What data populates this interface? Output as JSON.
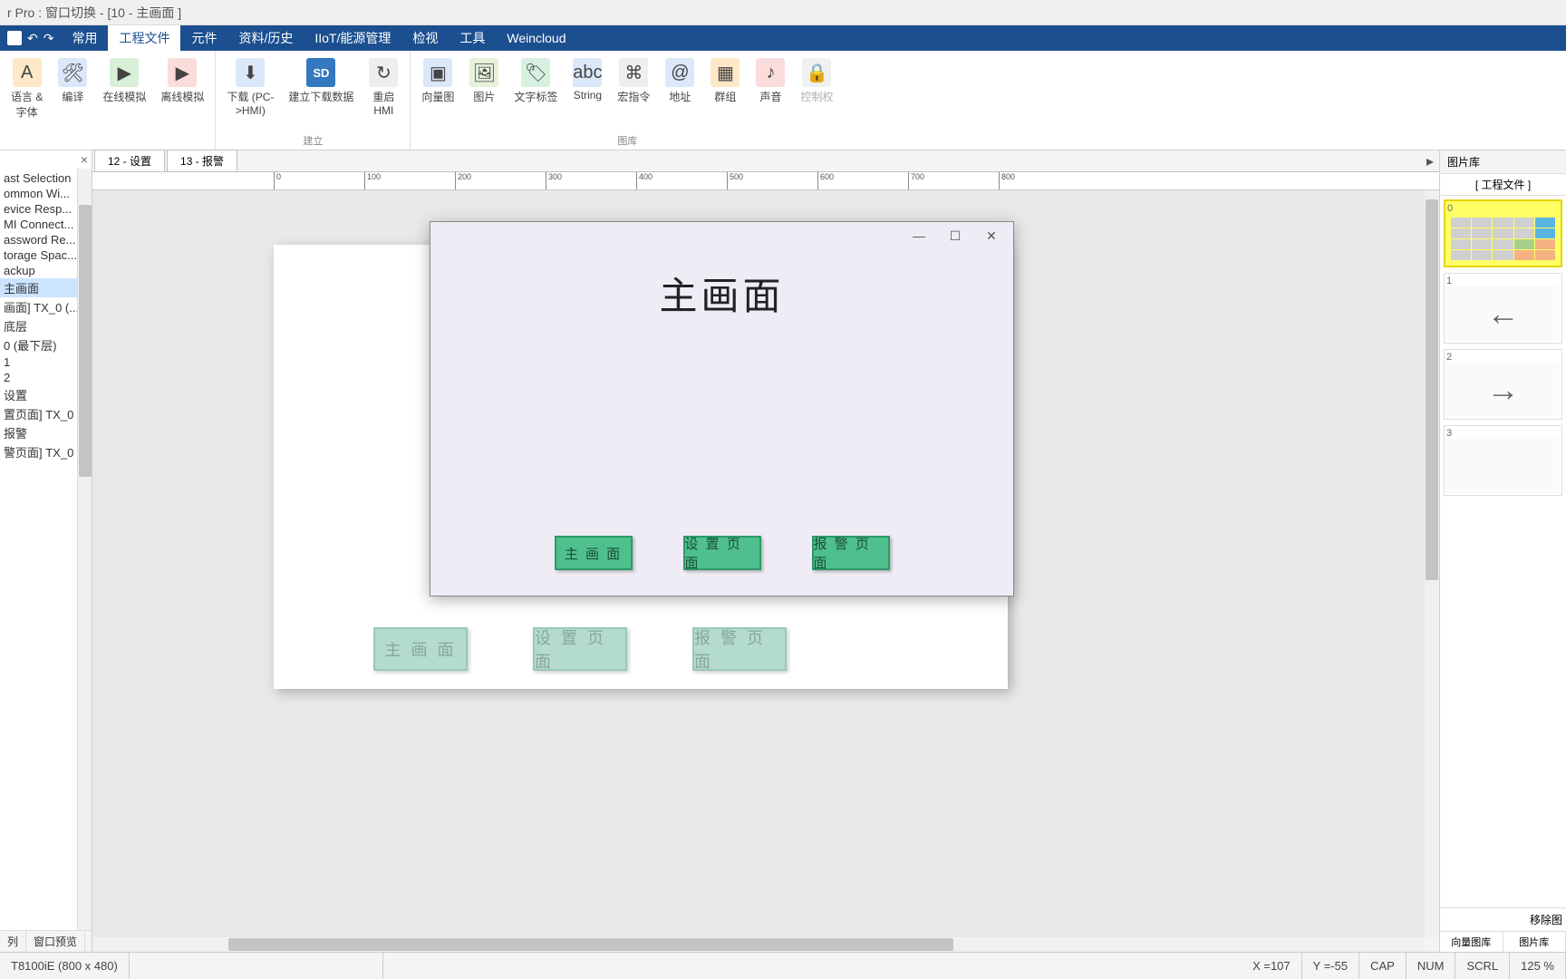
{
  "titlebar": "r Pro : 窗口切换 - [10 - 主画面 ]",
  "menu": {
    "items": [
      "常用",
      "工程文件",
      "元件",
      "资料/历史",
      "IIoT/能源管理",
      "检视",
      "工具",
      "Weincloud"
    ],
    "active_index": 1
  },
  "ribbon": {
    "btns": [
      {
        "label": "语言 &\n字体",
        "color": "#f0a030"
      },
      {
        "label": "编译",
        "color": "#5b8def"
      },
      {
        "label": "在线模拟",
        "color": "#4caf50"
      },
      {
        "label": "离线模拟",
        "color": "#e05050"
      },
      {
        "label": "下载 (PC-\n>HMI)",
        "color": "#5b8def"
      },
      {
        "label": "建立下载数据",
        "color": "#3478c0",
        "badge": "SD"
      },
      {
        "label": "重启\nHMI",
        "color": "#888"
      },
      {
        "label": "向量图",
        "color": "#3478c0"
      },
      {
        "label": "图片",
        "color": "#78b05a"
      },
      {
        "label": "文字标签",
        "color": "#58c070"
      },
      {
        "label": "String",
        "color": "#5b8def"
      },
      {
        "label": "宏指令",
        "color": "#999"
      },
      {
        "label": "地址",
        "color": "#5b8def"
      },
      {
        "label": "群组",
        "color": "#f0a030"
      },
      {
        "label": "声音",
        "color": "#e05050"
      },
      {
        "label": "控制权",
        "color": "#b8b8b8",
        "disabled": true
      }
    ],
    "groups": [
      "建立",
      "图库"
    ]
  },
  "left": {
    "items": [
      "ast Selection",
      "ommon Wi...",
      "evice Resp...",
      "MI Connect...",
      "assword Re...",
      "torage Spac...",
      "ackup",
      "主画面",
      "画面] TX_0 (...",
      "底层",
      "0 (最下层)",
      "1",
      "2",
      "设置",
      "置页面] TX_0 ...",
      "报警",
      "警页面] TX_0 ..."
    ],
    "selected_index": 7,
    "tabs": [
      "列",
      "窗口预览"
    ]
  },
  "doc_tabs": [
    "12 - 设置",
    "13 - 报警"
  ],
  "ruler_marks": [
    "0",
    "100",
    "200",
    "300",
    "400",
    "500",
    "600",
    "700",
    "800"
  ],
  "design_bg_buttons": [
    "主 画 面",
    "设 置 页 面",
    "报 警 页 面"
  ],
  "runtime": {
    "title": "主画面",
    "buttons": [
      "主 画 面",
      "设 置 页 面",
      "报 警 页 面"
    ]
  },
  "right": {
    "title": "图片库",
    "subtitle": "[ 工程文件 ]",
    "items": [
      {
        "num": "0",
        "type": "keypad"
      },
      {
        "num": "1",
        "type": "arrow-left"
      },
      {
        "num": "2",
        "type": "arrow-right"
      },
      {
        "num": "3",
        "type": "blank"
      }
    ],
    "remove": "移除图",
    "tabs": [
      "向量图库",
      "图片库"
    ]
  },
  "status": {
    "model": "T8100iE (800 x 480)",
    "x_label": "X = ",
    "x": "107",
    "y_label": "Y = ",
    "y": "-55",
    "caps": "CAP",
    "num": "NUM",
    "scrl": "SCRL",
    "zoom": "125 %"
  }
}
